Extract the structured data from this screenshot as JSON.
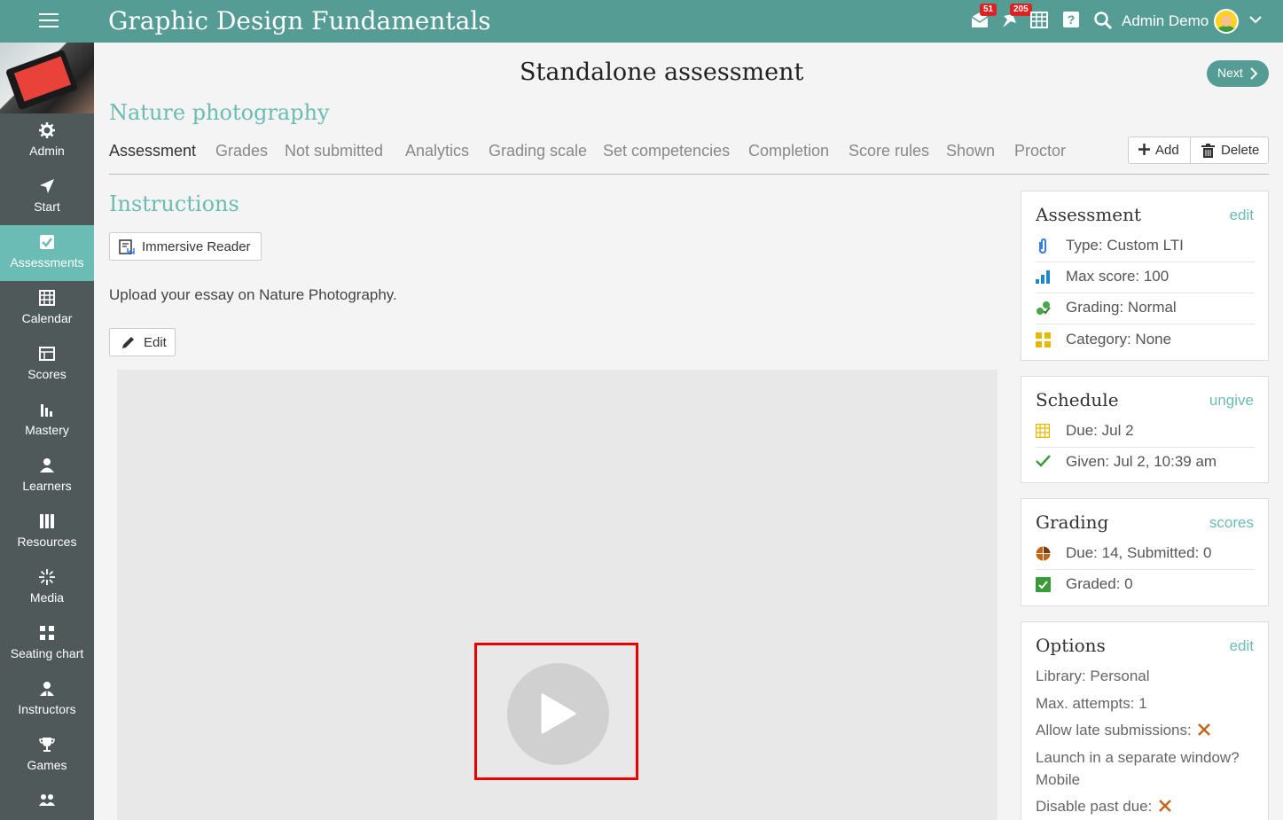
{
  "app": {
    "title": "Graphic Design Fundamentals"
  },
  "topbar": {
    "messages_badge": "51",
    "notifications_badge": "205",
    "user_name": "Admin Demo"
  },
  "sidebar": {
    "items": [
      {
        "label": "Admin",
        "icon": "gear-icon"
      },
      {
        "label": "Start",
        "icon": "navigate-icon"
      },
      {
        "label": "Assessments",
        "icon": "check-square-icon",
        "active": true
      },
      {
        "label": "Calendar",
        "icon": "calendar-icon"
      },
      {
        "label": "Scores",
        "icon": "scores-icon"
      },
      {
        "label": "Mastery",
        "icon": "bar-chart-icon"
      },
      {
        "label": "Learners",
        "icon": "person-icon"
      },
      {
        "label": "Resources",
        "icon": "books-icon"
      },
      {
        "label": "Media",
        "icon": "media-icon"
      },
      {
        "label": "Seating chart",
        "icon": "seating-icon"
      },
      {
        "label": "Instructors",
        "icon": "instructor-icon"
      },
      {
        "label": "Games",
        "icon": "trophy-icon"
      }
    ]
  },
  "main": {
    "page_title": "Standalone assessment",
    "next_label": "Next",
    "subtitle": "Nature photography",
    "tabs": [
      "Assessment",
      "Grades",
      "Not submitted",
      "Analytics",
      "Grading scale",
      "Set competencies",
      "Completion",
      "Score rules",
      "Shown",
      "Proctor"
    ],
    "add_label": "Add",
    "delete_label": "Delete",
    "instructions_title": "Instructions",
    "immersive_label": "Immersive Reader",
    "instructions_text": "Upload your essay on Nature Photography.",
    "edit_label": "Edit"
  },
  "cards": {
    "assessment": {
      "title": "Assessment",
      "link": "edit",
      "rows": [
        "Type: Custom LTI",
        "Max score: 100",
        "Grading: Normal",
        "Category: None"
      ]
    },
    "schedule": {
      "title": "Schedule",
      "link": "ungive",
      "rows": [
        "Due: Jul 2",
        "Given: Jul 2, 10:39 am"
      ]
    },
    "grading": {
      "title": "Grading",
      "link": "scores",
      "rows": [
        "Due: 14, Submitted: 0",
        "Graded: 0"
      ]
    },
    "options": {
      "title": "Options",
      "link": "edit",
      "library": "Library: Personal",
      "max_attempts": "Max. attempts: 1",
      "late": "Allow late submissions:",
      "launch": "Launch in a separate window?",
      "launch_value": "Mobile",
      "past_due": "Disable past due:"
    }
  },
  "colors": {
    "accent": "#559c94",
    "teal_text": "#6bbcb4",
    "sidebar": "#4f5959"
  }
}
